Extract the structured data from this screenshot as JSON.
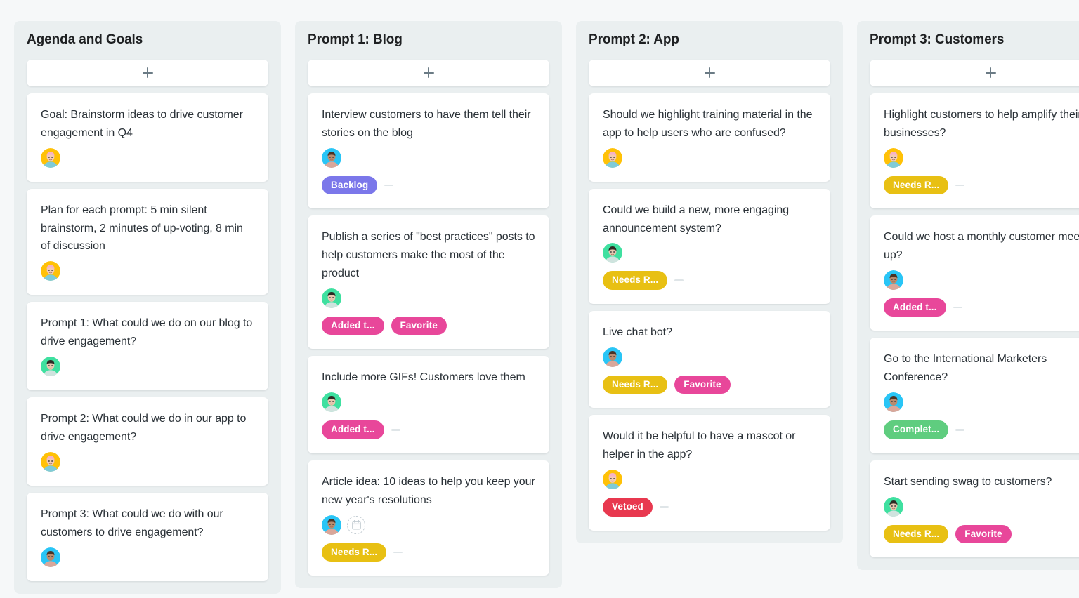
{
  "board": {
    "add_card_icon": "plus-icon",
    "date_icon": "calendar-icon",
    "colors": {
      "page_background": "#f6f8f9",
      "column_background": "#eaeff0",
      "card_background": "#ffffff",
      "text": "#2a3137",
      "tag_backlog": "#7b77ea",
      "tag_added": "#e8479a",
      "tag_favorite": "#e8479a",
      "tag_needs_review": "#e8c013",
      "tag_completed": "#5fcd7f",
      "tag_vetoed": "#e8384f"
    },
    "columns": [
      {
        "title": "Agenda and Goals",
        "add_label": "+",
        "cards": [
          {
            "text": "Goal: Brainstorm ideas to drive customer engagement in Q4",
            "avatar": "avatar-yellow",
            "has_date_placeholder": false,
            "tags": [],
            "has_dash": false
          },
          {
            "text": "Plan for each prompt: 5 min silent brainstorm, 2 minutes of up-voting, 8 min of discussion",
            "avatar": "avatar-yellow",
            "has_date_placeholder": false,
            "tags": [],
            "has_dash": false
          },
          {
            "text": "Prompt 1: What could we do on our blog to drive engagement?",
            "avatar": "avatar-green",
            "has_date_placeholder": false,
            "tags": [],
            "has_dash": false
          },
          {
            "text": "Prompt 2: What could we do in our app to drive engagement?",
            "avatar": "avatar-yellow",
            "has_date_placeholder": false,
            "tags": [],
            "has_dash": false
          },
          {
            "text": "Prompt 3: What could we do with our customers to drive engagement?",
            "avatar": "avatar-blue",
            "has_date_placeholder": false,
            "tags": [],
            "has_dash": false
          }
        ]
      },
      {
        "title": "Prompt 1: Blog",
        "add_label": "+",
        "cards": [
          {
            "text": "Interview customers to have them tell their stories on the blog",
            "avatar": "avatar-blue",
            "has_date_placeholder": false,
            "tags": [
              {
                "label": "Backlog",
                "color": "#7b77ea"
              }
            ],
            "has_dash": true
          },
          {
            "text": "Publish a series of \"best practices\" posts to help customers make the most of the product",
            "avatar": "avatar-green",
            "has_date_placeholder": false,
            "tags": [
              {
                "label": "Added t...",
                "color": "#e8479a"
              },
              {
                "label": "Favorite",
                "color": "#e8479a"
              }
            ],
            "has_dash": false
          },
          {
            "text": "Include more GIFs! Customers love them",
            "avatar": "avatar-green",
            "has_date_placeholder": false,
            "tags": [
              {
                "label": "Added t...",
                "color": "#e8479a"
              }
            ],
            "has_dash": true
          },
          {
            "text": "Article idea: 10 ideas to help you keep your new year's resolutions",
            "avatar": "avatar-blue",
            "has_date_placeholder": true,
            "tags": [
              {
                "label": "Needs R...",
                "color": "#e8c013"
              }
            ],
            "has_dash": true
          }
        ]
      },
      {
        "title": "Prompt 2: App",
        "add_label": "+",
        "cards": [
          {
            "text": "Should we highlight training material in the app to help users who are confused?",
            "avatar": "avatar-yellow",
            "has_date_placeholder": false,
            "tags": [],
            "has_dash": false
          },
          {
            "text": "Could we build a new, more engaging announcement system?",
            "avatar": "avatar-green",
            "has_date_placeholder": false,
            "tags": [
              {
                "label": "Needs R...",
                "color": "#e8c013"
              }
            ],
            "has_dash": true
          },
          {
            "text": "Live chat bot?",
            "avatar": "avatar-blue",
            "has_date_placeholder": false,
            "tags": [
              {
                "label": "Needs R...",
                "color": "#e8c013"
              },
              {
                "label": "Favorite",
                "color": "#e8479a"
              }
            ],
            "has_dash": false
          },
          {
            "text": "Would it be helpful to have a mascot or helper in the app?",
            "avatar": "avatar-yellow",
            "has_date_placeholder": false,
            "tags": [
              {
                "label": "Vetoed",
                "color": "#e8384f"
              }
            ],
            "has_dash": true
          }
        ]
      },
      {
        "title": "Prompt 3: Customers",
        "add_label": "+",
        "cards": [
          {
            "text": "Highlight customers to help amplify their businesses?",
            "avatar": "avatar-yellow",
            "has_date_placeholder": false,
            "tags": [
              {
                "label": "Needs R...",
                "color": "#e8c013"
              }
            ],
            "has_dash": true
          },
          {
            "text": "Could we host a monthly customer meet up?",
            "avatar": "avatar-blue",
            "has_date_placeholder": false,
            "tags": [
              {
                "label": "Added t...",
                "color": "#e8479a"
              }
            ],
            "has_dash": true
          },
          {
            "text": "Go to the International Marketers Conference?",
            "avatar": "avatar-blue",
            "has_date_placeholder": false,
            "tags": [
              {
                "label": "Complet...",
                "color": "#5fcd7f"
              }
            ],
            "has_dash": true
          },
          {
            "text": "Start sending swag to customers?",
            "avatar": "avatar-green",
            "has_date_placeholder": false,
            "tags": [
              {
                "label": "Needs R...",
                "color": "#e8c013"
              },
              {
                "label": "Favorite",
                "color": "#e8479a"
              }
            ],
            "has_dash": false
          }
        ]
      }
    ]
  }
}
